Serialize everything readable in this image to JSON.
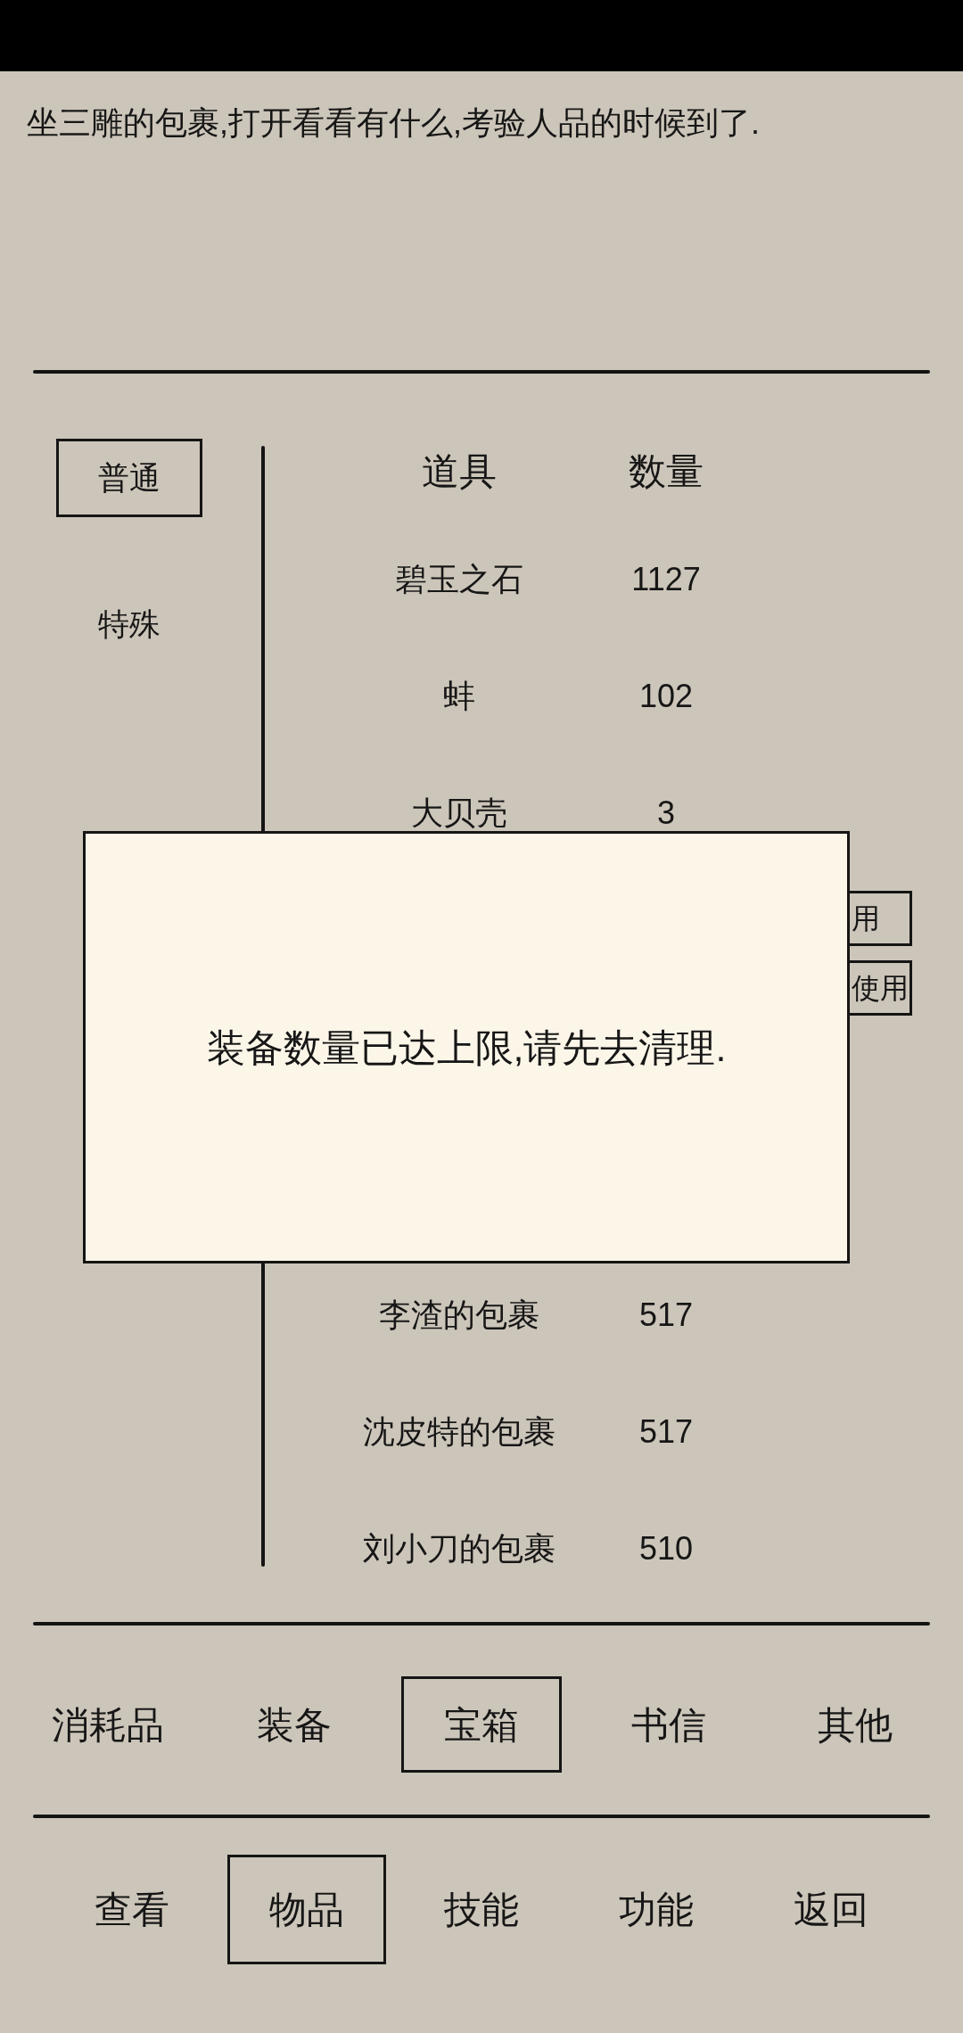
{
  "message": "坐三雕的包裹,打开看看有什么,考验人品的时候到了.",
  "filter_tabs": [
    {
      "label": "普通",
      "selected": true
    },
    {
      "label": "特殊",
      "selected": false
    }
  ],
  "table": {
    "columns": [
      "道具",
      "数量"
    ],
    "rows_above_dialog": [
      {
        "item": "碧玉之石",
        "count": "1127"
      },
      {
        "item": "蚌",
        "count": "102"
      },
      {
        "item": "大贝壳",
        "count": "3"
      }
    ],
    "row_buttons_beside_dialog": [
      {
        "label": "用"
      },
      {
        "label": "使用"
      }
    ],
    "rows_below_dialog": [
      {
        "item": "李渣的包裹",
        "count": "517"
      },
      {
        "item": "沈皮特的包裹",
        "count": "517"
      },
      {
        "item": "刘小刀的包裹",
        "count": "510"
      }
    ]
  },
  "dialog": {
    "message": "装备数量已达上限,请先去清理."
  },
  "category_tabs": [
    {
      "label": "消耗品",
      "selected": false
    },
    {
      "label": "装备",
      "selected": false
    },
    {
      "label": "宝箱",
      "selected": true
    },
    {
      "label": "书信",
      "selected": false
    },
    {
      "label": "其他",
      "selected": false
    }
  ],
  "nav_tabs": [
    {
      "label": "查看",
      "selected": false
    },
    {
      "label": "物品",
      "selected": true
    },
    {
      "label": "技能",
      "selected": false
    },
    {
      "label": "功能",
      "selected": false
    },
    {
      "label": "返回",
      "selected": false
    }
  ]
}
